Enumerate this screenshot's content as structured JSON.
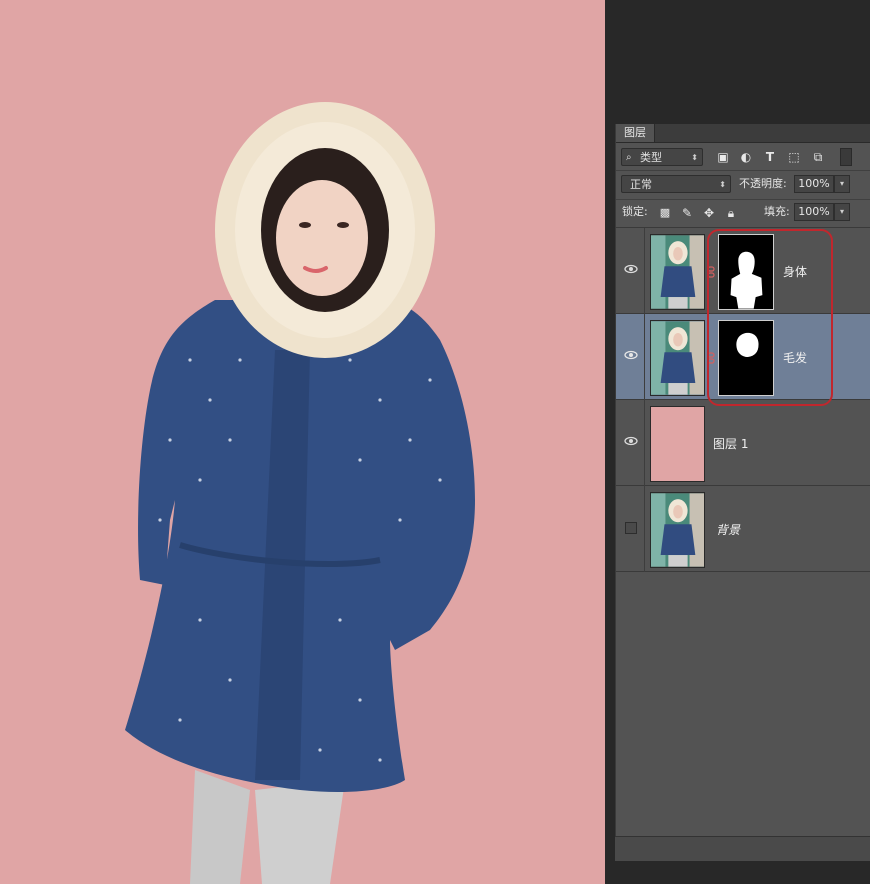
{
  "colors": {
    "canvas_bg": "#e0a5a5",
    "panel_bg": "#535353",
    "selected_row": "#6f7f97",
    "highlight": "#c1272d"
  },
  "panel": {
    "tab": "图层",
    "filter": {
      "icon": "search-icon",
      "value": "类型"
    },
    "blend_mode": "正常",
    "opacity_label": "不透明度:",
    "opacity_value": "100%",
    "lock_label": "锁定:",
    "fill_label": "填充:",
    "fill_value": "100%"
  },
  "layers": [
    {
      "name": "身体",
      "visible": true,
      "selected": false,
      "has_mask": true
    },
    {
      "name": "毛发",
      "visible": true,
      "selected": true,
      "has_mask": true
    },
    {
      "name": "图层 1",
      "visible": true,
      "selected": false,
      "has_mask": false
    },
    {
      "name": "背景",
      "visible": false,
      "selected": false,
      "has_mask": false
    }
  ]
}
